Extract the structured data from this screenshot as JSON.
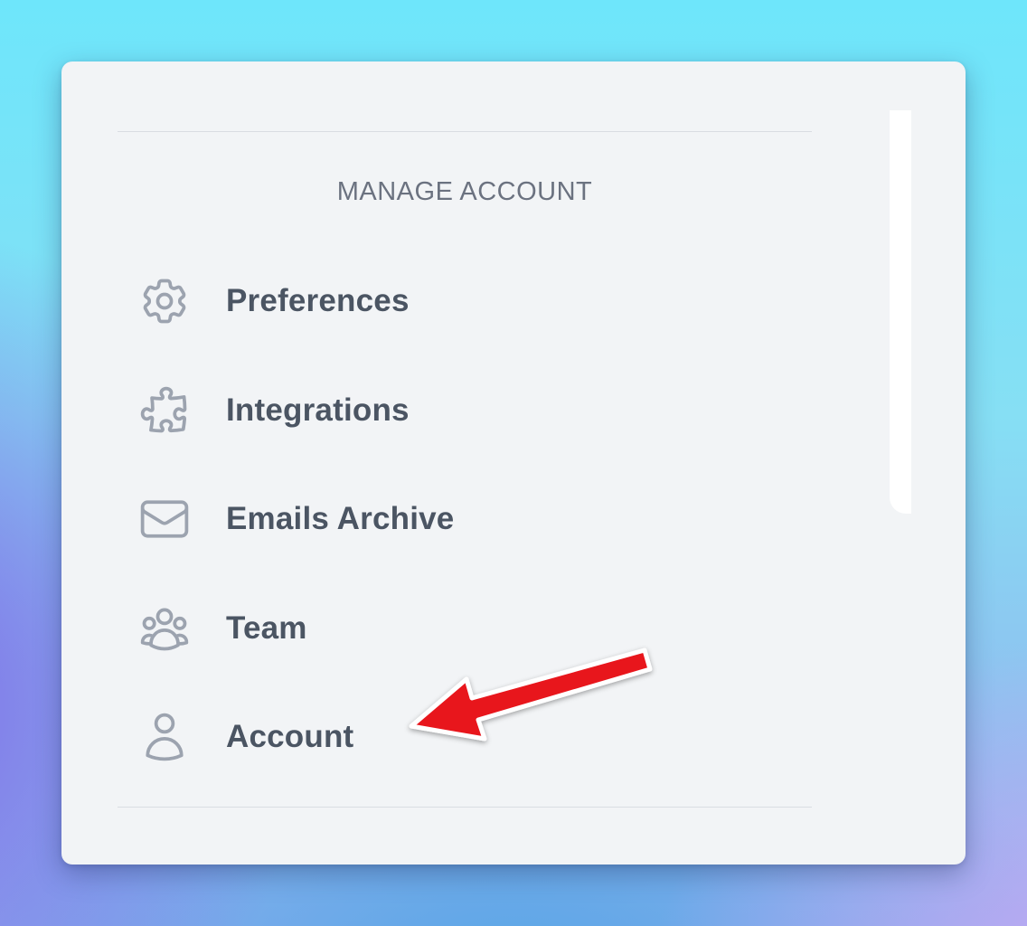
{
  "menu": {
    "heading": "MANAGE ACCOUNT",
    "items": [
      {
        "label": "Preferences",
        "icon": "gear-icon"
      },
      {
        "label": "Integrations",
        "icon": "puzzle-icon"
      },
      {
        "label": "Emails Archive",
        "icon": "envelope-icon"
      },
      {
        "label": "Team",
        "icon": "user-group-icon"
      },
      {
        "label": "Account",
        "icon": "user-icon"
      }
    ]
  },
  "colors": {
    "panel_background": "#f2f4f6",
    "heading_text": "#6b7280",
    "item_text": "#4b5563",
    "icon_stroke": "#9ca3af",
    "annotation_arrow": "#e8141c"
  }
}
